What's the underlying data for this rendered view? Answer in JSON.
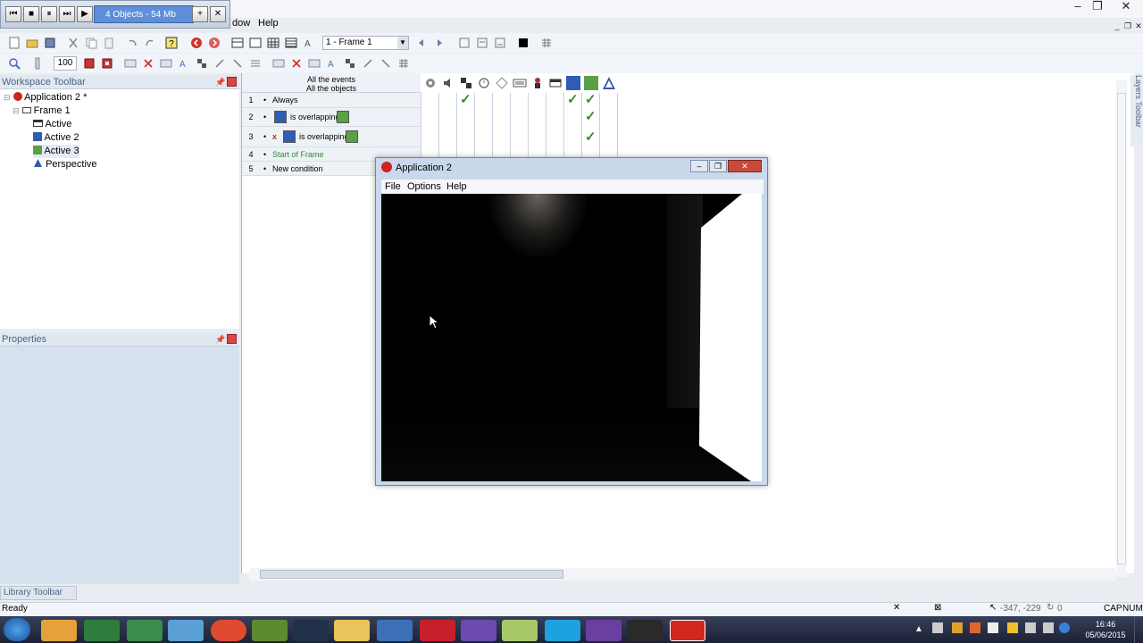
{
  "player": {
    "status": "4 Objects - 54 Mb",
    "buttons": [
      "⏮",
      "■",
      "⏸",
      "⏭",
      "▶"
    ]
  },
  "menubar": {
    "items": [
      "dow",
      "Help"
    ]
  },
  "toolbar": {
    "frame_select": "1 - Frame 1",
    "zoom": "100"
  },
  "workspace": {
    "title": "Workspace Toolbar",
    "tree": {
      "app": "Application 2 *",
      "frame": "Frame 1",
      "objects": [
        "Active",
        "Active 2",
        "Active 3",
        "Perspective"
      ]
    }
  },
  "properties": {
    "title": "Properties"
  },
  "library": {
    "title": "Library Toolbar"
  },
  "right_tab": "Layers Toolbar",
  "events": {
    "header": [
      "All the events",
      "All the objects"
    ],
    "rows": [
      {
        "num": "1",
        "text": "Always"
      },
      {
        "num": "2",
        "text": "is overlapping"
      },
      {
        "num": "3",
        "text": "is overlapping",
        "negated": "x"
      },
      {
        "num": "4",
        "text": "Start of Frame"
      },
      {
        "num": "5",
        "text": "New condition"
      }
    ],
    "checks": "✓"
  },
  "app_window": {
    "title": "Application 2",
    "menu": [
      "File",
      "Options",
      "Help"
    ]
  },
  "status": {
    "left": "Ready",
    "coords": "-347, -229",
    "zero": "0",
    "caps": "CAP",
    "num": "NUM"
  },
  "clock": {
    "time": "16:46",
    "date": "05/06/2015"
  },
  "colors": {
    "blue_obj": "#2f5db6",
    "green_obj": "#5aa046",
    "check": "#3a8a2a"
  }
}
